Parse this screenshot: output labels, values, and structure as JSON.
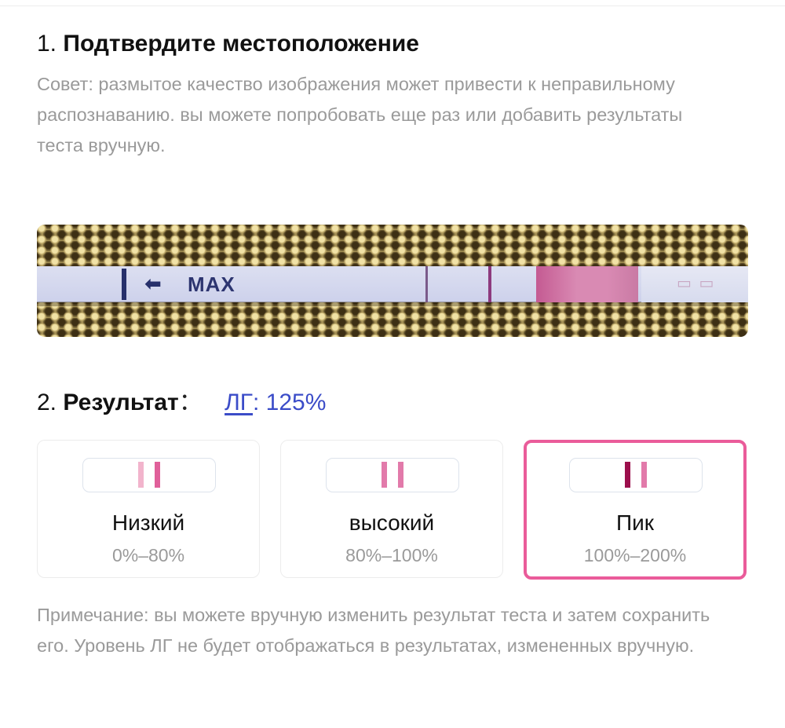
{
  "step1": {
    "number": "1.",
    "title": "Подтвердите местоположение",
    "tip": "Совет: размытое качество изображения может привести к неправильному распознаванию. вы можете попробовать еще раз или добавить результаты теста вручную."
  },
  "photo": {
    "strip_text": "MAX",
    "arrow_icon": "arrow-left-icon"
  },
  "step2": {
    "number": "2.",
    "title": "Результат",
    "colon": "：",
    "hormone": "ЛГ",
    "value_sep": ": ",
    "value": "125%"
  },
  "options": [
    {
      "label": "Низкий",
      "range": "0%–80%",
      "selected": false,
      "line_colors": [
        "#f2b4cc",
        "#e0609a"
      ]
    },
    {
      "label": "высокий",
      "range": "80%–100%",
      "selected": false,
      "line_colors": [
        "#e27aaa",
        "#e27aaa"
      ]
    },
    {
      "label": "Пик",
      "range": "100%–200%",
      "selected": true,
      "line_colors": [
        "#9c0f4c",
        "#e27aaa"
      ]
    }
  ],
  "note": "Примечание: вы можете вручную изменить результат теста и затем сохранить его. Уровень ЛГ не будет отображаться в результатах, измененных вручную.",
  "colors": {
    "accent_blue": "#3b4cc8",
    "selected_border": "#ea5c9a",
    "muted_text": "#9a9a9a"
  }
}
